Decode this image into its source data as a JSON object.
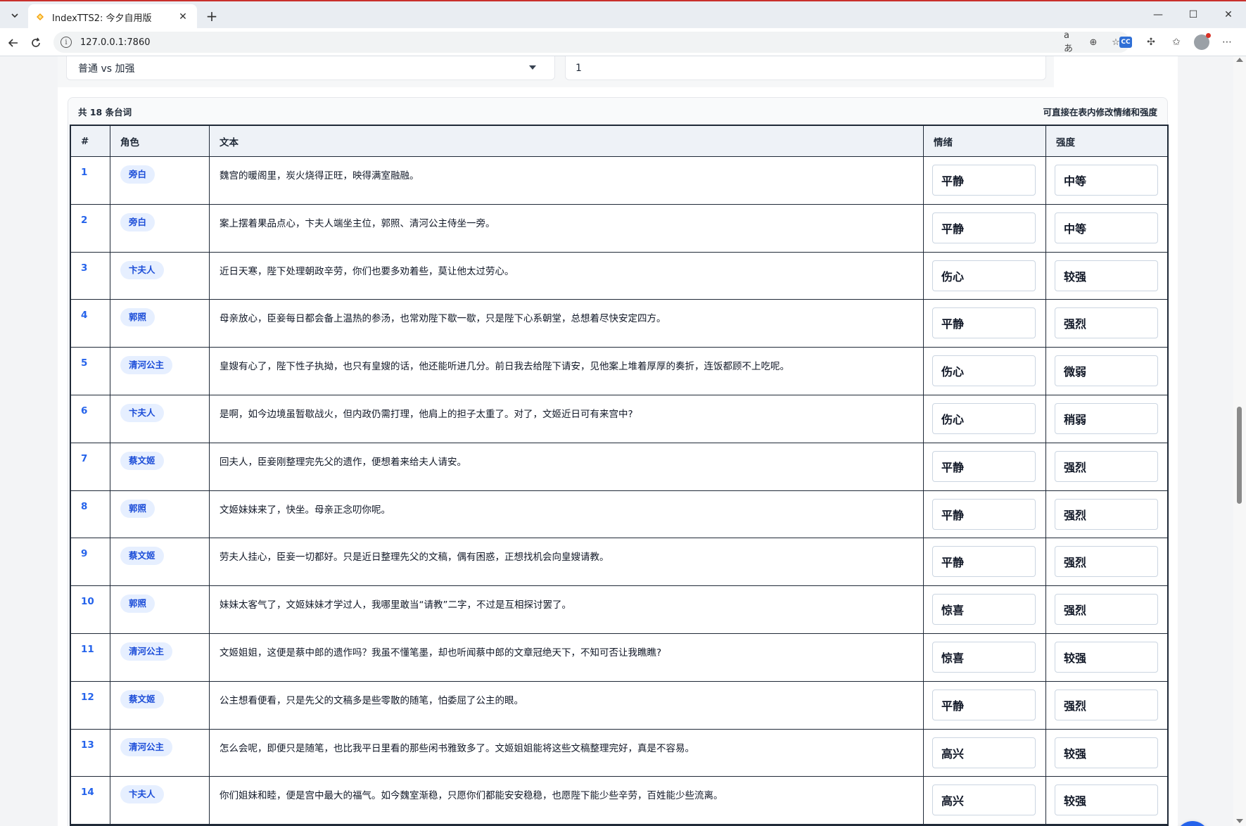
{
  "browser": {
    "tab_title": "IndexTTS2: 今夕自用版",
    "url": "127.0.0.1:7860"
  },
  "controls": {
    "dropdown_value": "普通 vs 加强",
    "number_value": "1"
  },
  "table": {
    "summary": "共 18 条台词",
    "hint": "可直接在表内修改情绪和强度",
    "headers": [
      "#",
      "角色",
      "文本",
      "情绪",
      "强度"
    ],
    "rows": [
      {
        "num": "1",
        "role": "旁白",
        "text": "魏宫的暖阁里，炭火烧得正旺，映得满室融融。",
        "emotion": "平静",
        "intensity": "中等"
      },
      {
        "num": "2",
        "role": "旁白",
        "text": "案上摆着果品点心，卞夫人端坐主位，郭照、清河公主侍坐一旁。",
        "emotion": "平静",
        "intensity": "中等"
      },
      {
        "num": "3",
        "role": "卞夫人",
        "text": "近日天寒，陛下处理朝政辛劳，你们也要多劝着些，莫让他太过劳心。",
        "emotion": "伤心",
        "intensity": "较强"
      },
      {
        "num": "4",
        "role": "郭照",
        "text": "母亲放心，臣妾每日都会备上温热的参汤，也常劝陛下歇一歇，只是陛下心系朝堂，总想着尽快安定四方。",
        "emotion": "平静",
        "intensity": "强烈"
      },
      {
        "num": "5",
        "role": "清河公主",
        "text": "皇嫂有心了，陛下性子执拗，也只有皇嫂的话，他还能听进几分。前日我去给陛下请安，见他案上堆着厚厚的奏折，连饭都顾不上吃呢。",
        "emotion": "伤心",
        "intensity": "微弱"
      },
      {
        "num": "6",
        "role": "卞夫人",
        "text": "是啊，如今边境虽暂歇战火，但内政仍需打理，他肩上的担子太重了。对了，文姬近日可有来宫中?",
        "emotion": "伤心",
        "intensity": "稍弱"
      },
      {
        "num": "7",
        "role": "蔡文姬",
        "text": "回夫人，臣妾刚整理完先父的遗作，便想着来给夫人请安。",
        "emotion": "平静",
        "intensity": "强烈"
      },
      {
        "num": "8",
        "role": "郭照",
        "text": "文姬妹妹来了，快坐。母亲正念叨你呢。",
        "emotion": "平静",
        "intensity": "强烈"
      },
      {
        "num": "9",
        "role": "蔡文姬",
        "text": "劳夫人挂心，臣妾一切都好。只是近日整理先父的文稿，偶有困惑，正想找机会向皇嫂请教。",
        "emotion": "平静",
        "intensity": "强烈"
      },
      {
        "num": "10",
        "role": "郭照",
        "text": "妹妹太客气了，文姬妹妹才学过人，我哪里敢当“请教”二字，不过是互相探讨罢了。",
        "emotion": "惊喜",
        "intensity": "强烈"
      },
      {
        "num": "11",
        "role": "清河公主",
        "text": "文姬姐姐，这便是蔡中郎的遗作吗？我虽不懂笔墨，却也听闻蔡中郎的文章冠绝天下，不知可否让我瞧瞧?",
        "emotion": "惊喜",
        "intensity": "较强"
      },
      {
        "num": "12",
        "role": "蔡文姬",
        "text": "公主想看便看，只是先父的文稿多是些零散的随笔，怕委屈了公主的眼。",
        "emotion": "平静",
        "intensity": "强烈"
      },
      {
        "num": "13",
        "role": "清河公主",
        "text": "怎么会呢，即便只是随笔，也比我平日里看的那些闲书雅致多了。文姬姐姐能将这些文稿整理完好，真是不容易。",
        "emotion": "高兴",
        "intensity": "较强"
      },
      {
        "num": "14",
        "role": "卞夫人",
        "text": "你们姐妹和睦，便是宫中最大的福气。如今魏室渐稳，只愿你们都能安安稳稳，也愿陛下能少些辛劳，百姓能少些流离。",
        "emotion": "高兴",
        "intensity": "较强"
      }
    ]
  },
  "colors": {
    "accent": "#2563eb",
    "role_pill_bg": "#e6efff",
    "header_bg": "#eef2f7"
  }
}
